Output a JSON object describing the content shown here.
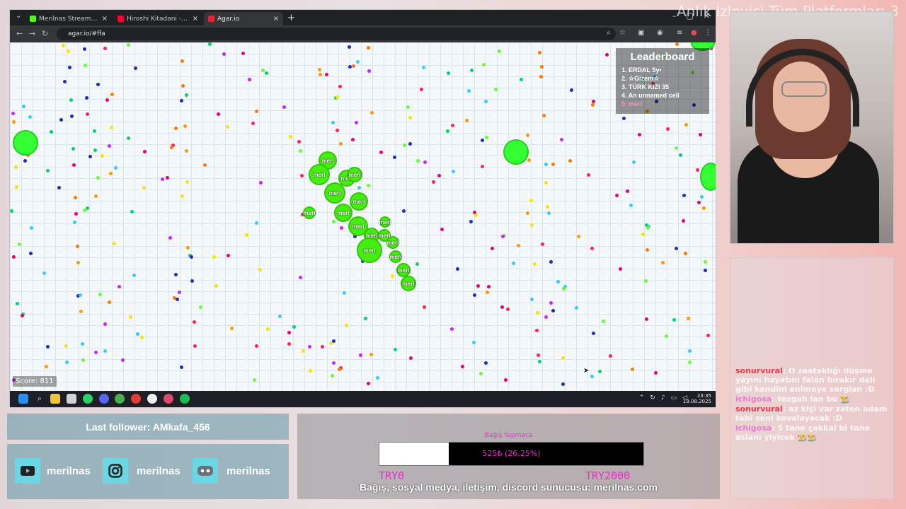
{
  "browser": {
    "tabs": [
      {
        "title": "Merilnas Stream - Watch Live o",
        "favicon_color": "#53fc18"
      },
      {
        "title": "Hiroshi Kitadani - We Are!",
        "favicon_color": "#ff0033"
      },
      {
        "title": "Agar.io",
        "favicon_color": "#e52236"
      }
    ],
    "url": "agar.io/#ffa"
  },
  "game": {
    "score_text": "Score: 811",
    "leaderboard": {
      "title": "Leaderboard",
      "entries": [
        "1. ERDAL 5y•",
        "2. ☆Gizem☆",
        "3. TÜRK KIZI  35",
        "4. An unnamed cell",
        "5. meri"
      ]
    },
    "cell_label": "meri",
    "colors": {
      "cell": "#44ee10",
      "grid_bg": "#f4f8fb"
    }
  },
  "taskbar": {
    "time": "23:35",
    "date": "19.08.2025"
  },
  "overlay": {
    "title": "Anlık İzleyici Tüm Platformlar: 3",
    "last_follower": "Last follower: AMkafa_456",
    "socials": [
      {
        "icon": "youtube-icon",
        "handle": "merilnas"
      },
      {
        "icon": "instagram-icon",
        "handle": "merilnas"
      },
      {
        "icon": "discord-icon",
        "handle": "merilnas"
      }
    ],
    "donation": {
      "title": "Bağış Yapmaca",
      "progress_text": "525₺ (26.25%)",
      "progress": 0.2625,
      "min": "TRY0",
      "max": "TRY2000",
      "footer": "Bağış, sosyal medya, iletişim, discord sunucusu: merilnas.com"
    },
    "chat": [
      {
        "user": "sonurvural",
        "text": "O zaataklığı düşme yayını hayatını falan bırakır deli gibi kendini anlmeye sorgian :D"
      },
      {
        "user": "ichigosa",
        "text": "tezgah lan bu 👨‍🌾"
      },
      {
        "user": "sonurvural",
        "text": "az kişi var zaten adam tabi seni kovalayacak :D"
      },
      {
        "user": "ichigosa",
        "text": "5 tane çakkal bi tane aslanı yiyicek 👨‍🌾👨‍🌾"
      }
    ]
  }
}
